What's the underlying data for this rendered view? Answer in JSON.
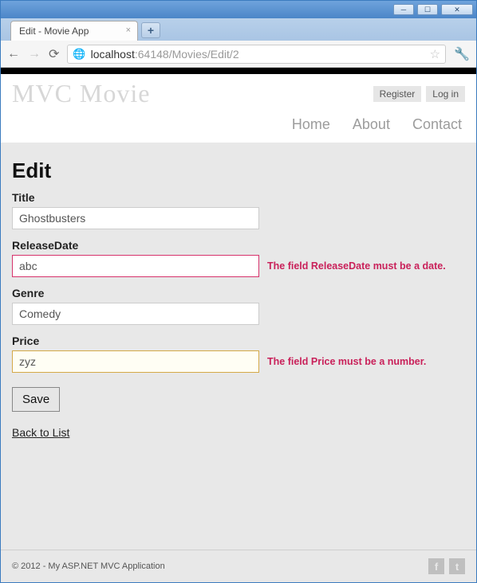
{
  "window": {
    "tab_title": "Edit - Movie App",
    "url_host": "localhost",
    "url_port": ":64148",
    "url_path": "/Movies/Edit/2"
  },
  "header": {
    "logo": "MVC Movie",
    "auth": {
      "register": "Register",
      "login": "Log in"
    },
    "nav": {
      "home": "Home",
      "about": "About",
      "contact": "Contact"
    }
  },
  "page": {
    "heading": "Edit",
    "fields": {
      "title": {
        "label": "Title",
        "value": "Ghostbusters"
      },
      "releaseDate": {
        "label": "ReleaseDate",
        "value": "abc",
        "error": "The field ReleaseDate must be a date."
      },
      "genre": {
        "label": "Genre",
        "value": "Comedy"
      },
      "price": {
        "label": "Price",
        "value": "zyz",
        "error": "The field Price must be a number."
      }
    },
    "save": "Save",
    "back": "Back to List"
  },
  "footer": {
    "copyright": "© 2012 - My ASP.NET MVC Application"
  }
}
